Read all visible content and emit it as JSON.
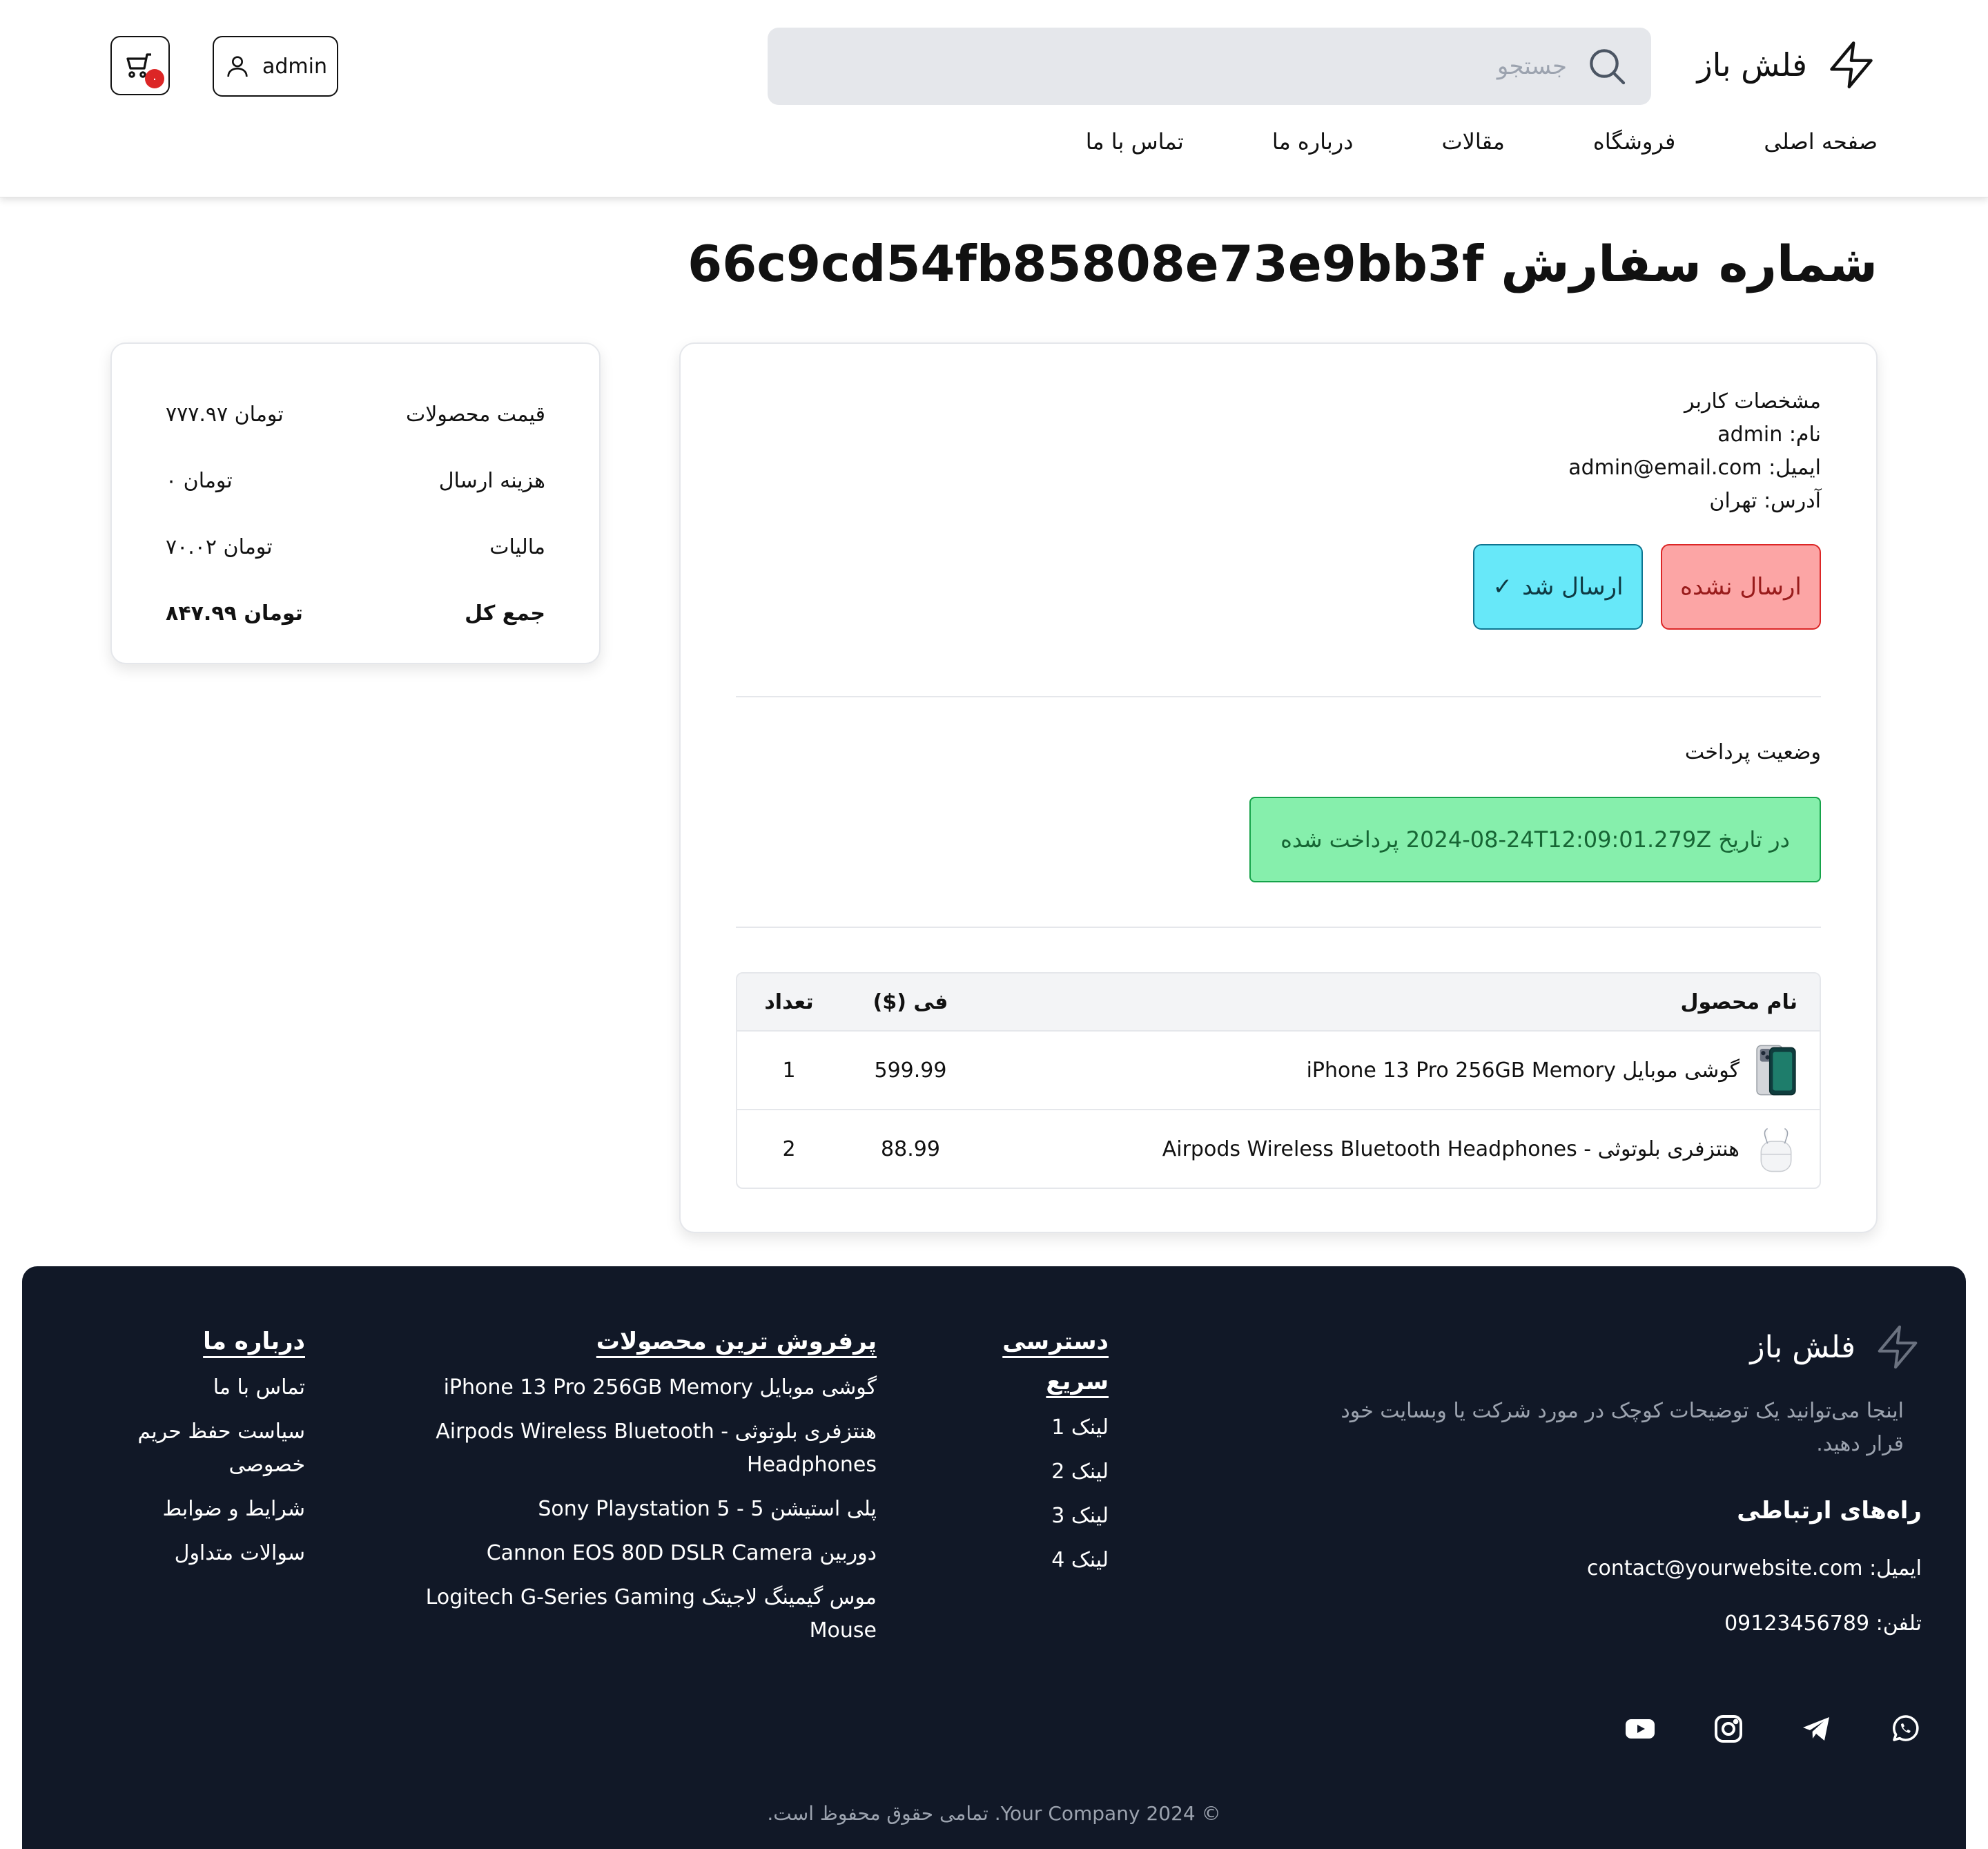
{
  "header": {
    "brand": "فلش باز",
    "search_placeholder": "جستجو",
    "user_label": "admin",
    "cart_count": "۰",
    "nav": [
      "صفحه اصلی",
      "فروشگاه",
      "مقالات",
      "درباره ما",
      "تماس با ما"
    ]
  },
  "order": {
    "title_prefix": "شماره سفارش",
    "id": "66c9cd54fb85808e73e9bb3f"
  },
  "summary": {
    "rows": [
      {
        "label": "قیمت محصولات",
        "value": "تومان ۷۷۷.۹۷"
      },
      {
        "label": "هزینه ارسال",
        "value": "تومان ۰"
      },
      {
        "label": "مالیات",
        "value": "تومان ۷۰.۰۲"
      },
      {
        "label": "جمع کل",
        "value": "تومان ۸۴۷.۹۹"
      }
    ]
  },
  "user_details": {
    "heading": "مشخصات کاربر",
    "name_label": "نام:",
    "name": "admin",
    "email_label": "ایمیل:",
    "email": "admin@email.com",
    "address_label": "آدرس:",
    "address": "تهران"
  },
  "shipping": {
    "not_shipped_label": "ارسال نشده",
    "shipped_label": "ارسال شد",
    "shipped_check": "✓"
  },
  "payment": {
    "label": "وضعیت پرداخت",
    "prefix": "در تاریخ",
    "date": "2024-08-24T12:09:01.279Z",
    "suffix": "پرداخت شده"
  },
  "items_table": {
    "headers": {
      "name": "نام محصول",
      "price": "فی ($)",
      "qty": "تعداد"
    },
    "rows": [
      {
        "name": "گوشی موبایل iPhone 13 Pro 256GB Memory",
        "price": "599.99",
        "qty": "1",
        "thumb": "phone-icon"
      },
      {
        "name": "هنتزفری بلوتوثی - Airpods Wireless Bluetooth Headphones",
        "price": "88.99",
        "qty": "2",
        "thumb": "earbuds-icon"
      }
    ]
  },
  "footer": {
    "brand": "فلش باز",
    "description": "اینجا می‌توانید یک توضیحات کوچک در مورد شرکت یا وبسایت خود قرار دهید.",
    "contact_title": "راه‌های ارتباطی",
    "email_label": "ایمیل:",
    "email": "contact@yourwebsite.com",
    "phone_label": "تلفن:",
    "phone": "09123456789",
    "social": [
      "whatsapp-icon",
      "telegram-icon",
      "instagram-icon",
      "youtube-icon"
    ],
    "quick_access": {
      "title": "دسترسی سریع",
      "links": [
        "لینک 1",
        "لینک 2",
        "لینک 3",
        "لینک 4"
      ]
    },
    "best_sellers": {
      "title": "پرفروش ترین محصولات",
      "links": [
        "گوشی موبایل iPhone 13 Pro 256GB Memory",
        "هنتزفری بلوتوثی - Airpods Wireless Bluetooth Headphones",
        "پلی استیشن 5 - Sony Playstation 5",
        "دوربین Cannon EOS 80D DSLR Camera",
        "موس گیمینگ لاجیتک Logitech G-Series Gaming Mouse"
      ]
    },
    "about": {
      "title": "درباره ما",
      "links": [
        "تماس با ما",
        "سیاست حفظ حریم خصوصی",
        "شرایط و ضوابط",
        "سوالات متداول"
      ]
    },
    "copyright": "© 2024 Your Company. تمامی حقوق محفوظ است."
  }
}
